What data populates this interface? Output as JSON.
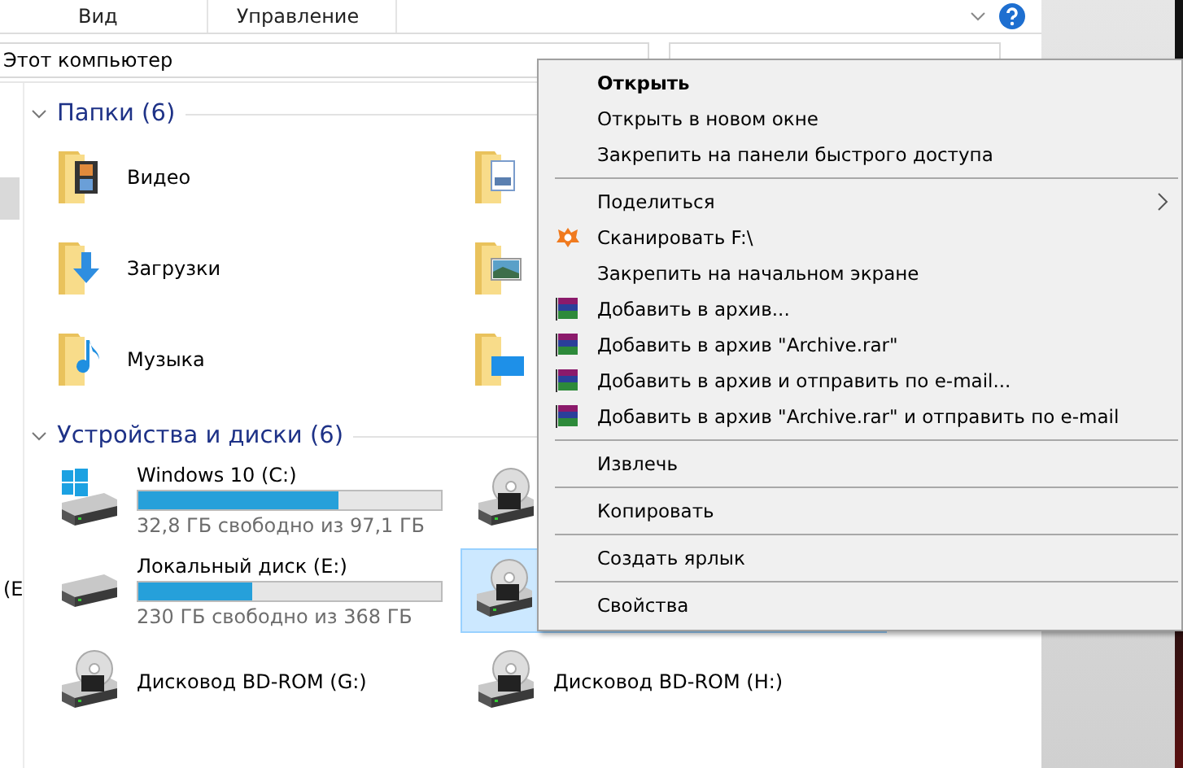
{
  "ribbon": {
    "tabs": [
      {
        "label": "Вид",
        "selected": false
      },
      {
        "label": "Управление",
        "selected": false
      }
    ]
  },
  "address": {
    "path": "Этот компьютер"
  },
  "sidebar": {
    "items": [
      {
        "label": "(E",
        "selected": false
      }
    ]
  },
  "sections": [
    {
      "title": "Папки (6)",
      "expanded": true,
      "kind": "folders",
      "items": [
        {
          "kind": "video",
          "name": "Видео"
        },
        {
          "kind": "documents"
        },
        {
          "kind": "downloads",
          "name": "Загрузки"
        },
        {
          "kind": "pictures"
        },
        {
          "kind": "music",
          "name": "Музыка"
        },
        {
          "kind": "desktop"
        }
      ]
    },
    {
      "title": "Устройства и диски (6)",
      "expanded": true,
      "kind": "drives",
      "items": [
        {
          "kind": "windows",
          "name": "Windows 10 (C:)",
          "level": 0.662,
          "free": "32,8 ГБ свободно из 97,1 ГБ",
          "selected": false
        },
        {
          "kind": "bd",
          "selected": false
        },
        {
          "kind": "hdd",
          "name": "Локальный диск (E:)",
          "level": 0.375,
          "free": "230 ГБ свободно из 368 ГБ",
          "selected": false
        },
        {
          "kind": "bd",
          "selected": true
        },
        {
          "kind": "bd",
          "name": "Дисковод BD-ROM (G:)",
          "selected": false
        },
        {
          "kind": "bd",
          "name": "Дисковод BD-ROM (H:)",
          "selected": false
        }
      ]
    }
  ],
  "context_menu": {
    "groups": [
      [
        {
          "label": "Открыть",
          "default": true
        },
        {
          "label": "Открыть в новом окне"
        },
        {
          "label": "Закрепить на панели быстрого доступа"
        }
      ],
      [
        {
          "label": "Поделиться",
          "submenu": true
        },
        {
          "label": "Сканировать F:\\",
          "kind": "shield"
        },
        {
          "label": "Закрепить на начальном экране"
        },
        {
          "label": "Добавить в архив...",
          "kind": "books"
        },
        {
          "label": "Добавить в архив \"Archive.rar\"",
          "kind": "books"
        },
        {
          "label": "Добавить в архив и отправить по e-mail...",
          "kind": "books"
        },
        {
          "label": "Добавить в архив \"Archive.rar\" и отправить по e-mail",
          "kind": "books"
        }
      ],
      [
        {
          "label": "Извлечь"
        }
      ],
      [
        {
          "label": "Копировать"
        }
      ],
      [
        {
          "label": "Создать ярлык"
        }
      ],
      [
        {
          "label": "Свойства"
        }
      ]
    ]
  }
}
